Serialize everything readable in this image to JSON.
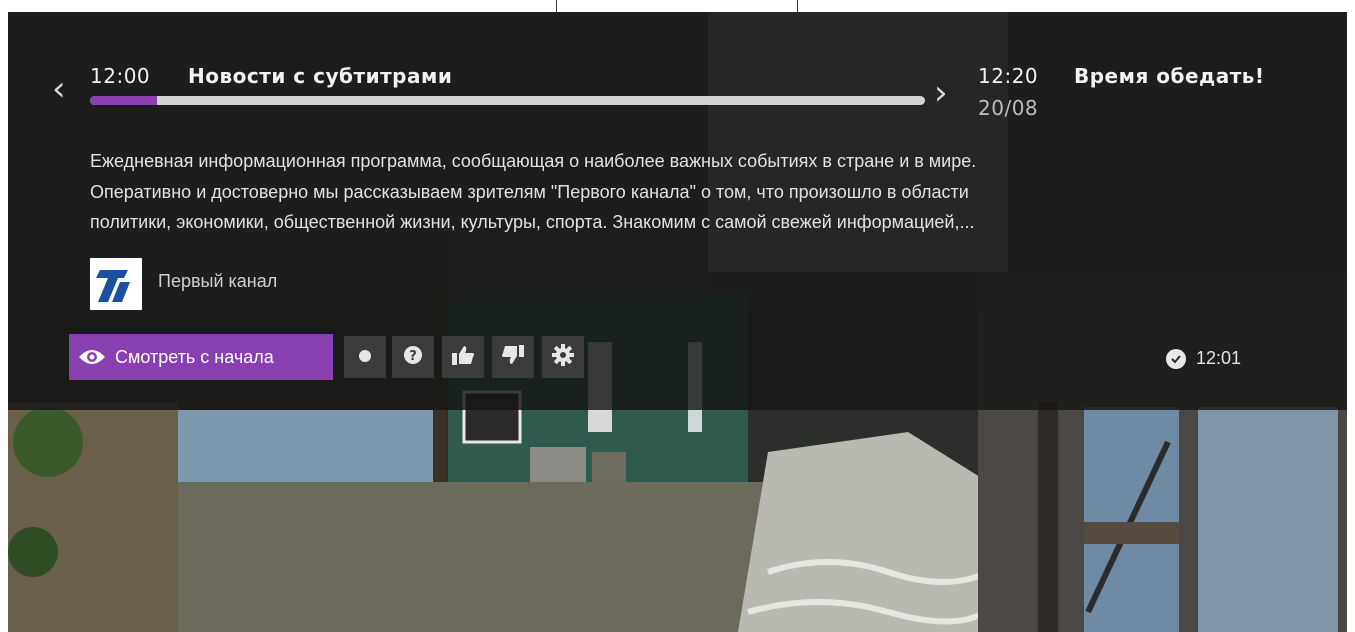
{
  "now": {
    "time": "12:00",
    "title": "Новости с субтитрами",
    "progress": 0.08
  },
  "next": {
    "time": "12:20",
    "title": "Время обедать!",
    "date": "20/08"
  },
  "description": {
    "line1": "Ежедневная информационная программа, сообщающая о наиболее важных событиях в стране и в мире.",
    "line2": "Оперативно и достоверно мы рассказываем зрителям \"Первого канала\" о том, что произошло в области",
    "line3": "политики, экономики, общественной жизни, культуры, спорта. Знакомим с самой свежей информацией,..."
  },
  "channel": {
    "name": "Первый канал",
    "logo_icon": "channel-one-logo"
  },
  "actions": {
    "watch_from_start": "Смотреть с начала",
    "icons": [
      "eye-icon",
      "record-icon",
      "help-icon",
      "thumbs-up-icon",
      "thumbs-down-icon",
      "settings-icon"
    ]
  },
  "clock": {
    "time": "12:01",
    "icon": "check-icon"
  },
  "colors": {
    "accent": "#8a3fb0",
    "progress_track": "#d2d2d2",
    "overlay": "#161616"
  }
}
